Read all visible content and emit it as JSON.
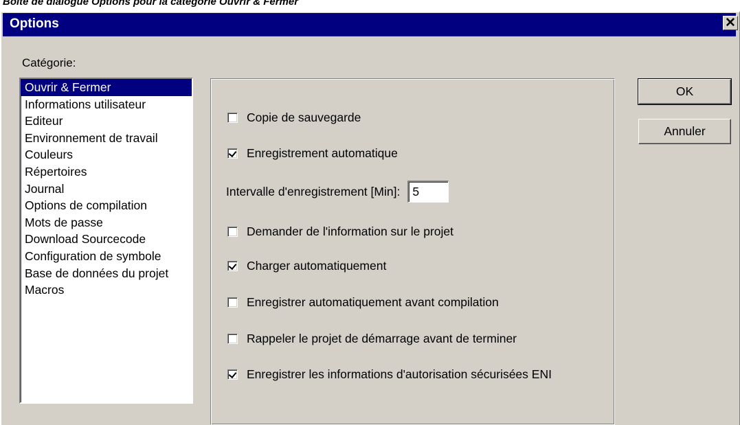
{
  "caption": "Boîte de dialogue Options pour la catégorie Ouvrir & Fermer",
  "window": {
    "title": "Options",
    "close_glyph": "✕"
  },
  "category": {
    "label": "Catégorie:",
    "items": [
      "Ouvrir & Fermer",
      "Informations utilisateur",
      "Editeur",
      "Environnement de travail",
      "Couleurs",
      "Répertoires",
      "Journal",
      "Options de compilation",
      "Mots de passe",
      "Download Sourcecode",
      "Configuration de symbole",
      "Base de données du projet",
      "Macros"
    ],
    "selected_index": 0
  },
  "options": {
    "backup": {
      "label": "Copie de sauvegarde",
      "checked": false
    },
    "autosave": {
      "label": "Enregistrement automatique",
      "checked": true
    },
    "interval": {
      "label": "Intervalle d'enregistrement [Min]:",
      "value": "5"
    },
    "ask_project_info": {
      "label": "Demander de l'information sur le projet",
      "checked": false
    },
    "autoload": {
      "label": "Charger automatiquement",
      "checked": true
    },
    "autosave_before_compile": {
      "label": "Enregistrer automatiquement avant compilation",
      "checked": false
    },
    "remind_boot_project": {
      "label": "Rappeler  le projet de démarrage avant de terminer",
      "checked": false
    },
    "save_eni_credentials": {
      "label": "Enregistrer les informations d'autorisation sécurisées ENI",
      "checked": true
    }
  },
  "buttons": {
    "ok": "OK",
    "cancel": "Annuler"
  },
  "colors": {
    "titlebar": "#000080",
    "face": "#d4d0c8",
    "selection": "#000080"
  }
}
